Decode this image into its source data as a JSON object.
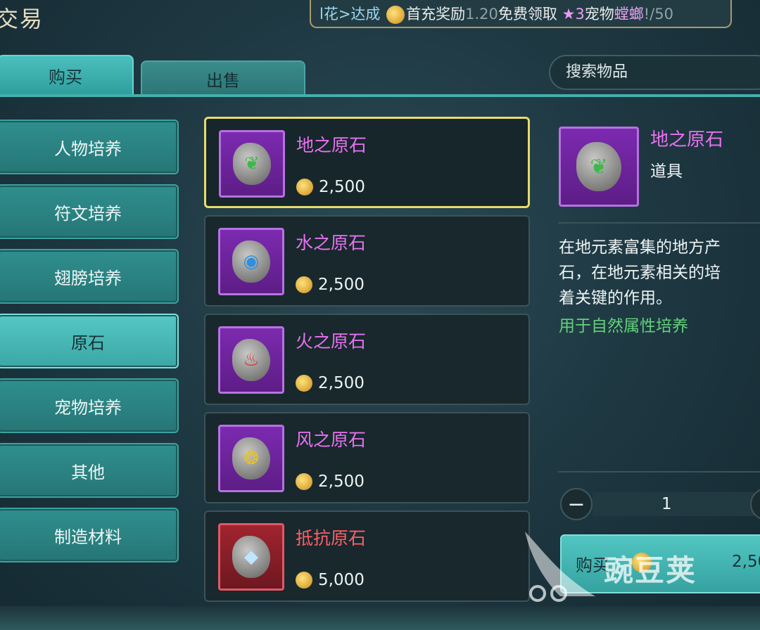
{
  "title": "交易",
  "ticker": {
    "part1": "l花>达成",
    "part2": "首充奖励",
    "part3": "1.20",
    "part4": "免费领取",
    "part5": "★3",
    "part6": "宠物",
    "part7": "螳螂",
    "part8": "!/50"
  },
  "tabs": {
    "buy": "购买",
    "sell": "出售"
  },
  "search": {
    "placeholder": "搜索物品"
  },
  "categories": [
    {
      "label": "人物培养"
    },
    {
      "label": "符文培养"
    },
    {
      "label": "翅膀培养"
    },
    {
      "label": "原石",
      "active": true
    },
    {
      "label": "宠物培养"
    },
    {
      "label": "其他"
    },
    {
      "label": "制造材料"
    }
  ],
  "items": [
    {
      "name": "地之原石",
      "price": "2,500",
      "icon": "earth-stone-icon",
      "selected": true
    },
    {
      "name": "水之原石",
      "price": "2,500",
      "icon": "water-stone-icon"
    },
    {
      "name": "火之原石",
      "price": "2,500",
      "icon": "fire-stone-icon"
    },
    {
      "name": "风之原石",
      "price": "2,500",
      "icon": "wind-stone-icon"
    },
    {
      "name": "抵抗原石",
      "price": "5,000",
      "icon": "resist-stone-icon"
    }
  ],
  "detail": {
    "name": "地之原石",
    "type": "道具",
    "desc": "在地元素富集的地方产\n石，在地元素相关的培\n着关键的作用。",
    "use": "用于自然属性培养",
    "quantity": "1",
    "buy_label": "购买",
    "buy_price": "2,50"
  },
  "watermark": "豌豆荚",
  "colors": {
    "accent": "#43b0ad",
    "rare_name": "#e872f0",
    "epic_name": "#ff5e67",
    "select_border": "#e6dc6a",
    "use_text": "#62d27a"
  }
}
